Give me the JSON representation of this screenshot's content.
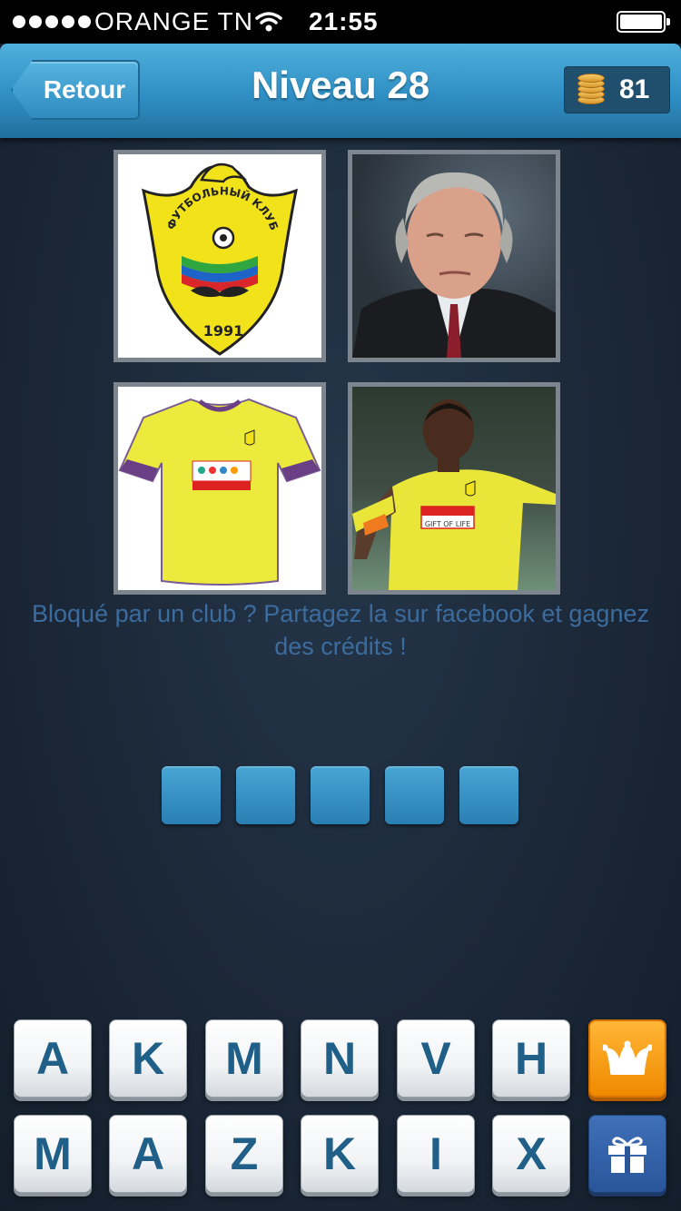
{
  "status_bar": {
    "carrier": "ORANGE TN",
    "time": "21:55"
  },
  "header": {
    "back_label": "Retour",
    "title": "Niveau 28",
    "coins": "81"
  },
  "images": {
    "crest_text_top": "ФУТБОЛЬНЫЙ КЛУБ",
    "crest_year": "1991",
    "shirt_sponsor_text": "GIFT OF LIFE"
  },
  "hint": "Bloqué par un club ? Partagez la sur facebook et gagnez des crédits !",
  "answer_slots": 5,
  "keyboard": {
    "row1": [
      "A",
      "K",
      "M",
      "N",
      "V",
      "H"
    ],
    "row2": [
      "M",
      "A",
      "Z",
      "K",
      "I",
      "X"
    ]
  },
  "colors": {
    "header_blue": "#2f8fc4",
    "letter_blue": "#1f5f88",
    "hint_blue": "#3c6c9e",
    "joker_orange": "#f08a00",
    "gift_blue": "#2a559b",
    "crest_yellow": "#f2e21a"
  },
  "icons": {
    "joker": "jester-hat-icon",
    "gift": "gift-icon",
    "coins": "coin-stack-icon"
  }
}
